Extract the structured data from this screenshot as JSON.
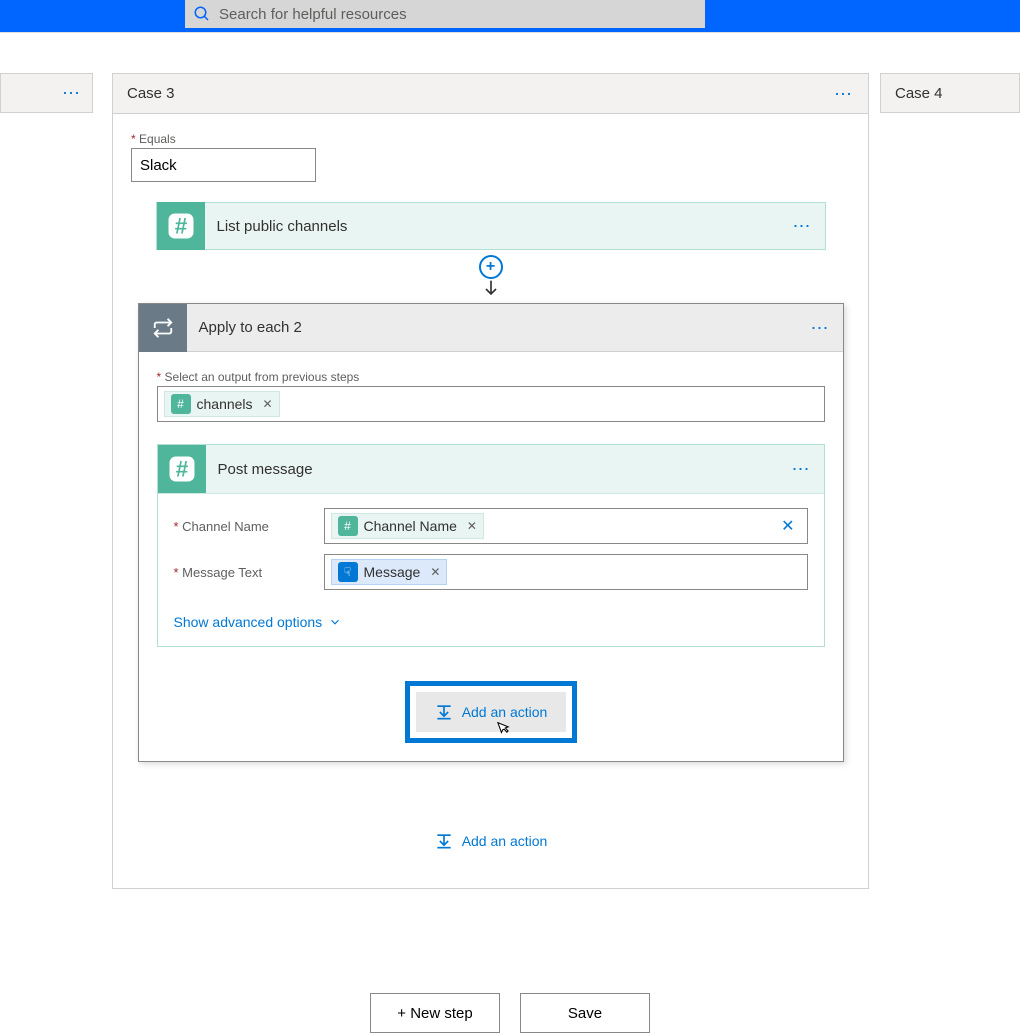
{
  "search": {
    "placeholder": "Search for helpful resources"
  },
  "cases": {
    "prev_title": "",
    "main_title": "Case 3",
    "next_title": "Case 4"
  },
  "equals": {
    "label": "Equals",
    "value": "Slack"
  },
  "step_list": {
    "title": "List public channels"
  },
  "apply": {
    "title": "Apply to each 2",
    "select_label": "Select an output from previous steps",
    "token": "channels"
  },
  "post": {
    "title": "Post message",
    "field_channel": "Channel Name",
    "token_channel": "Channel Name",
    "field_message": "Message Text",
    "token_message": "Message",
    "advanced": "Show advanced options"
  },
  "actions": {
    "add_action_inner": "Add an action",
    "add_action_outer": "Add an action"
  },
  "footer": {
    "new_step": "+ New step",
    "save": "Save"
  }
}
